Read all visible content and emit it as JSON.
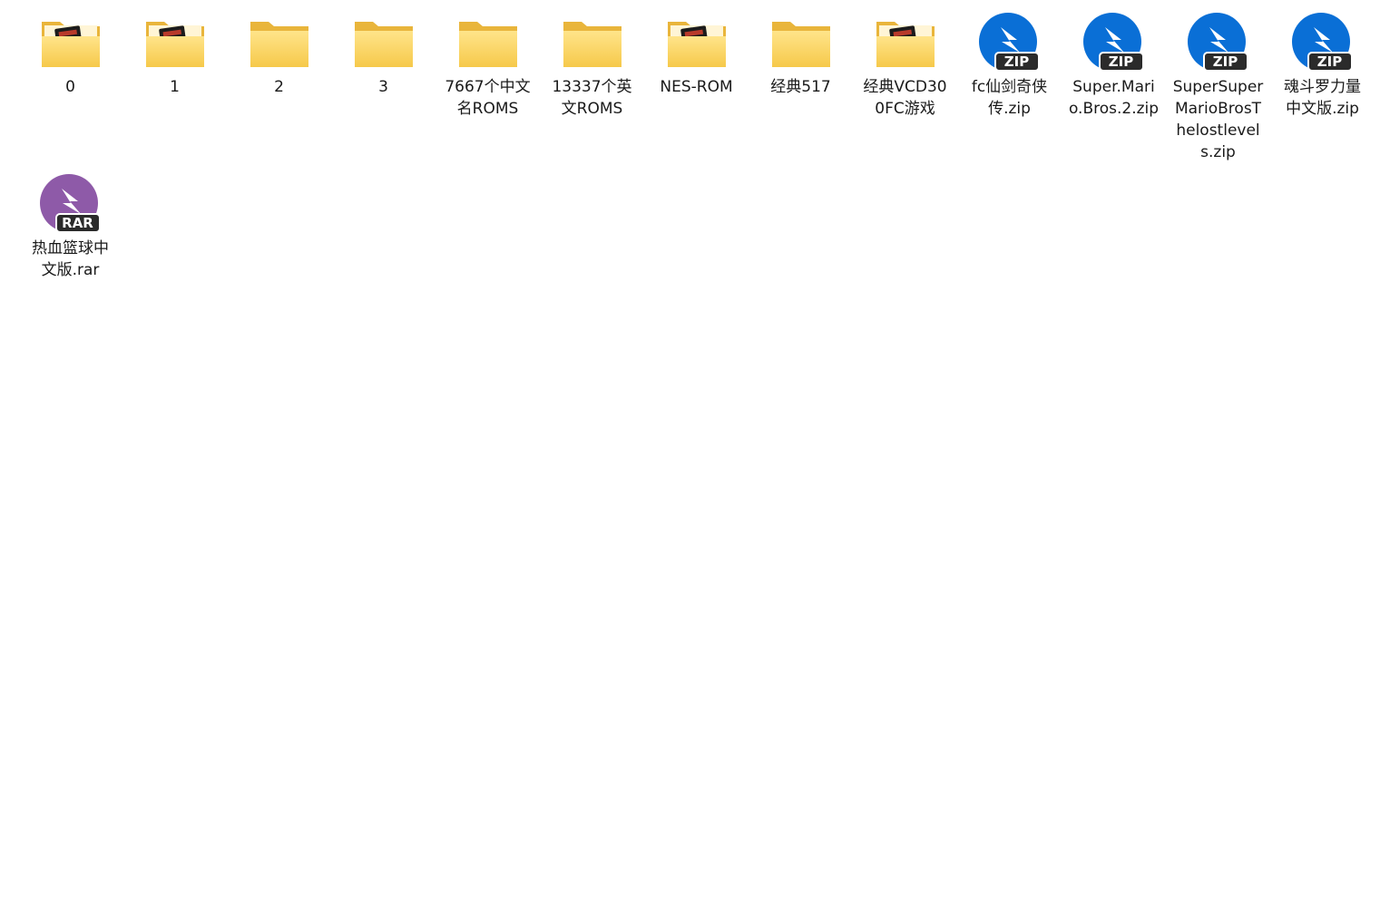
{
  "colors": {
    "folder_back": "#e9b53b",
    "folder_front_top": "#ffe48a",
    "folder_front_bottom": "#f6c94a",
    "zip_badge": "#0a6fd6",
    "rar_badge": "#8e5aa8",
    "tag_bg": "#2b2b2b"
  },
  "items": [
    {
      "type": "folder",
      "preview": true,
      "name": "0"
    },
    {
      "type": "folder",
      "preview": true,
      "name": "1"
    },
    {
      "type": "folder",
      "preview": false,
      "name": "2"
    },
    {
      "type": "folder",
      "preview": false,
      "name": "3"
    },
    {
      "type": "folder",
      "preview": false,
      "name": "7667个中文名ROMS"
    },
    {
      "type": "folder",
      "preview": false,
      "name": "13337个英文ROMS"
    },
    {
      "type": "folder",
      "preview": true,
      "name": "NES-ROM"
    },
    {
      "type": "folder",
      "preview": false,
      "name": "经典517"
    },
    {
      "type": "folder",
      "preview": true,
      "name": "经典VCD300FC游戏"
    },
    {
      "type": "zip",
      "tag": "ZIP",
      "name": "fc仙剑奇侠传.zip"
    },
    {
      "type": "zip",
      "tag": "ZIP",
      "name": "Super.Mario.Bros.2.zip"
    },
    {
      "type": "zip",
      "tag": "ZIP",
      "name": "SuperSuperMarioBrosThelostlevels.zip"
    },
    {
      "type": "zip",
      "tag": "ZIP",
      "name": "魂斗罗力量中文版.zip"
    },
    {
      "type": "rar",
      "tag": "RAR",
      "name": "热血篮球中文版.rar"
    }
  ]
}
